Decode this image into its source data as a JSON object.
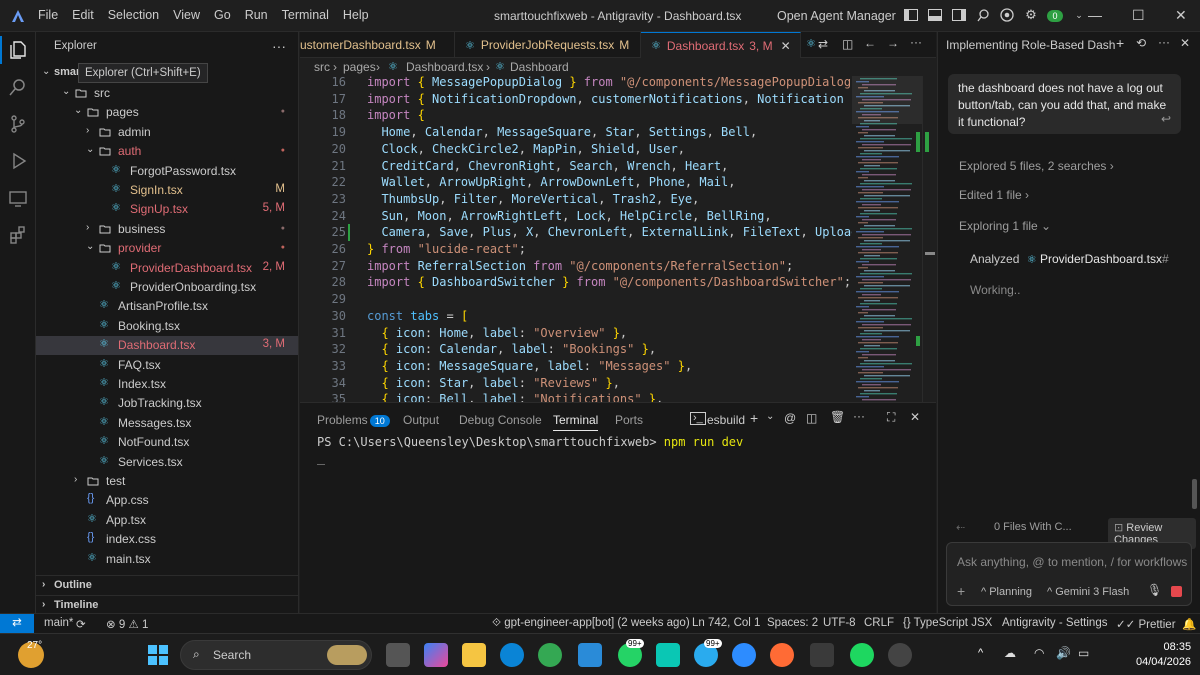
{
  "window": {
    "title": "smarttouchfixweb - Antigravity - Dashboard.tsx",
    "agent_manager": "Open Agent Manager",
    "badge": "0"
  },
  "menu": [
    "File",
    "Edit",
    "Selection",
    "View",
    "Go",
    "Run",
    "Terminal",
    "Help"
  ],
  "sidebar": {
    "title": "Explorer",
    "tooltip": "Explorer (Ctrl+Shift+E)",
    "root": "smar",
    "items": [
      {
        "name": "src",
        "depth": 1,
        "type": "folder",
        "open": true
      },
      {
        "name": "pages",
        "depth": 2,
        "type": "folder",
        "open": true,
        "dot": true
      },
      {
        "name": "admin",
        "depth": 3,
        "type": "folder",
        "open": false
      },
      {
        "name": "auth",
        "depth": 3,
        "type": "folder",
        "open": true,
        "dot": true,
        "color": "#e06c75"
      },
      {
        "name": "ForgotPassword.tsx",
        "depth": 4,
        "type": "file"
      },
      {
        "name": "SignIn.tsx",
        "depth": 4,
        "type": "file",
        "status": "M",
        "color": "#e2c08d"
      },
      {
        "name": "SignUp.tsx",
        "depth": 4,
        "type": "file",
        "status": "5, M",
        "color": "#e06c75"
      },
      {
        "name": "business",
        "depth": 3,
        "type": "folder",
        "open": false,
        "dot": true
      },
      {
        "name": "provider",
        "depth": 3,
        "type": "folder",
        "open": true,
        "dot": true,
        "color": "#e06c75"
      },
      {
        "name": "ProviderDashboard.tsx",
        "depth": 4,
        "type": "file",
        "status": "2, M",
        "color": "#e06c75"
      },
      {
        "name": "ProviderOnboarding.tsx",
        "depth": 4,
        "type": "file"
      },
      {
        "name": "ArtisanProfile.tsx",
        "depth": 3,
        "type": "file"
      },
      {
        "name": "Booking.tsx",
        "depth": 3,
        "type": "file"
      },
      {
        "name": "Dashboard.tsx",
        "depth": 3,
        "type": "file",
        "status": "3, M",
        "color": "#e06c75",
        "selected": true
      },
      {
        "name": "FAQ.tsx",
        "depth": 3,
        "type": "file"
      },
      {
        "name": "Index.tsx",
        "depth": 3,
        "type": "file"
      },
      {
        "name": "JobTracking.tsx",
        "depth": 3,
        "type": "file"
      },
      {
        "name": "Messages.tsx",
        "depth": 3,
        "type": "file"
      },
      {
        "name": "NotFound.tsx",
        "depth": 3,
        "type": "file"
      },
      {
        "name": "Services.tsx",
        "depth": 3,
        "type": "file"
      },
      {
        "name": "test",
        "depth": 2,
        "type": "folder",
        "open": false
      },
      {
        "name": "App.css",
        "depth": 2,
        "type": "css"
      },
      {
        "name": "App.tsx",
        "depth": 2,
        "type": "file"
      },
      {
        "name": "index.css",
        "depth": 2,
        "type": "css"
      },
      {
        "name": "main.tsx",
        "depth": 2,
        "type": "file"
      }
    ],
    "outline": "Outline",
    "timeline": "Timeline"
  },
  "tabs": [
    {
      "label": "ustomerDashboard.tsx",
      "status": "M"
    },
    {
      "label": "ProviderJobRequests.tsx",
      "status": "M"
    },
    {
      "label": "Dashboard.tsx",
      "status": "3, M",
      "active": true
    }
  ],
  "breadcrumb": [
    "src",
    "pages",
    "Dashboard.tsx",
    "Dashboard"
  ],
  "code_lines": [
    {
      "n": "16",
      "t": [
        [
          "kw",
          "import "
        ],
        [
          "br",
          "{ "
        ],
        [
          "id",
          "MessagePopupDialog "
        ],
        [
          "br",
          "} "
        ],
        [
          "kw",
          "from "
        ],
        [
          "str",
          "\"@/components/MessagePopupDialog\""
        ],
        [
          "pn",
          ";"
        ]
      ]
    },
    {
      "n": "17",
      "t": [
        [
          "kw",
          "import "
        ],
        [
          "br",
          "{ "
        ],
        [
          "id",
          "NotificationDropdown"
        ],
        [
          "pn",
          ", "
        ],
        [
          "id",
          "customerNotifications"
        ],
        [
          "pn",
          ", "
        ],
        [
          "id",
          "Notification "
        ],
        [
          "br",
          "} "
        ],
        [
          "kw",
          "fro"
        ]
      ]
    },
    {
      "n": "18",
      "t": [
        [
          "kw",
          "import "
        ],
        [
          "br",
          "{"
        ]
      ]
    },
    {
      "n": "19",
      "t": [
        [
          "id",
          "  Home"
        ],
        [
          "pn",
          ", "
        ],
        [
          "id",
          "Calendar"
        ],
        [
          "pn",
          ", "
        ],
        [
          "id",
          "MessageSquare"
        ],
        [
          "pn",
          ", "
        ],
        [
          "id",
          "Star"
        ],
        [
          "pn",
          ", "
        ],
        [
          "id",
          "Settings"
        ],
        [
          "pn",
          ", "
        ],
        [
          "id",
          "Bell"
        ],
        [
          "pn",
          ","
        ]
      ]
    },
    {
      "n": "20",
      "t": [
        [
          "id",
          "  Clock"
        ],
        [
          "pn",
          ", "
        ],
        [
          "id",
          "CheckCircle2"
        ],
        [
          "pn",
          ", "
        ],
        [
          "id",
          "MapPin"
        ],
        [
          "pn",
          ", "
        ],
        [
          "id",
          "Shield"
        ],
        [
          "pn",
          ", "
        ],
        [
          "id",
          "User"
        ],
        [
          "pn",
          ","
        ]
      ]
    },
    {
      "n": "21",
      "t": [
        [
          "id",
          "  CreditCard"
        ],
        [
          "pn",
          ", "
        ],
        [
          "id",
          "ChevronRight"
        ],
        [
          "pn",
          ", "
        ],
        [
          "id",
          "Search"
        ],
        [
          "pn",
          ", "
        ],
        [
          "id",
          "Wrench"
        ],
        [
          "pn",
          ", "
        ],
        [
          "id",
          "Heart"
        ],
        [
          "pn",
          ","
        ]
      ]
    },
    {
      "n": "22",
      "t": [
        [
          "id",
          "  Wallet"
        ],
        [
          "pn",
          ", "
        ],
        [
          "id",
          "ArrowUpRight"
        ],
        [
          "pn",
          ", "
        ],
        [
          "id",
          "ArrowDownLeft"
        ],
        [
          "pn",
          ", "
        ],
        [
          "id",
          "Phone"
        ],
        [
          "pn",
          ", "
        ],
        [
          "id",
          "Mail"
        ],
        [
          "pn",
          ","
        ]
      ]
    },
    {
      "n": "23",
      "t": [
        [
          "id",
          "  ThumbsUp"
        ],
        [
          "pn",
          ", "
        ],
        [
          "id",
          "Filter"
        ],
        [
          "pn",
          ", "
        ],
        [
          "id",
          "MoreVertical"
        ],
        [
          "pn",
          ", "
        ],
        [
          "id",
          "Trash2"
        ],
        [
          "pn",
          ", "
        ],
        [
          "id",
          "Eye"
        ],
        [
          "pn",
          ","
        ]
      ]
    },
    {
      "n": "24",
      "t": [
        [
          "id",
          "  Sun"
        ],
        [
          "pn",
          ", "
        ],
        [
          "id",
          "Moon"
        ],
        [
          "pn",
          ", "
        ],
        [
          "id",
          "ArrowRightLeft"
        ],
        [
          "pn",
          ", "
        ],
        [
          "id",
          "Lock"
        ],
        [
          "pn",
          ", "
        ],
        [
          "id",
          "HelpCircle"
        ],
        [
          "pn",
          ", "
        ],
        [
          "id",
          "BellRing"
        ],
        [
          "pn",
          ","
        ]
      ]
    },
    {
      "n": "25",
      "t": [
        [
          "id",
          "  Camera"
        ],
        [
          "pn",
          ", "
        ],
        [
          "id",
          "Save"
        ],
        [
          "pn",
          ", "
        ],
        [
          "id",
          "Plus"
        ],
        [
          "pn",
          ", "
        ],
        [
          "id",
          "X"
        ],
        [
          "pn",
          ", "
        ],
        [
          "id",
          "ChevronLeft"
        ],
        [
          "pn",
          ", "
        ],
        [
          "id",
          "ExternalLink"
        ],
        [
          "pn",
          ", "
        ],
        [
          "id",
          "FileText"
        ],
        [
          "pn",
          ", "
        ],
        [
          "id",
          "Upload"
        ],
        [
          "pn",
          ", "
        ],
        [
          "id",
          "Al"
        ]
      ]
    },
    {
      "n": "26",
      "t": [
        [
          "br",
          "} "
        ],
        [
          "kw",
          "from "
        ],
        [
          "str",
          "\"lucide-react\""
        ],
        [
          "pn",
          ";"
        ]
      ]
    },
    {
      "n": "27",
      "t": [
        [
          "kw",
          "import "
        ],
        [
          "id",
          "ReferralSection "
        ],
        [
          "kw",
          "from "
        ],
        [
          "str",
          "\"@/components/ReferralSection\""
        ],
        [
          "pn",
          ";"
        ]
      ]
    },
    {
      "n": "28",
      "t": [
        [
          "kw",
          "import "
        ],
        [
          "br",
          "{ "
        ],
        [
          "id",
          "DashboardSwitcher "
        ],
        [
          "br",
          "} "
        ],
        [
          "kw",
          "from "
        ],
        [
          "str",
          "\"@/components/DashboardSwitcher\""
        ],
        [
          "pn",
          ";"
        ]
      ]
    },
    {
      "n": "29",
      "t": []
    },
    {
      "n": "30",
      "t": [
        [
          "dec",
          "const "
        ],
        [
          "cst",
          "tabs "
        ],
        [
          "pn",
          "= "
        ],
        [
          "br",
          "["
        ]
      ]
    },
    {
      "n": "31",
      "t": [
        [
          "pn",
          "  "
        ],
        [
          "br",
          "{ "
        ],
        [
          "id",
          "icon"
        ],
        [
          "pn",
          ": "
        ],
        [
          "id",
          "Home"
        ],
        [
          "pn",
          ", "
        ],
        [
          "id",
          "label"
        ],
        [
          "pn",
          ": "
        ],
        [
          "str",
          "\"Overview\" "
        ],
        [
          "br",
          "}"
        ],
        [
          "pn",
          ","
        ]
      ]
    },
    {
      "n": "32",
      "t": [
        [
          "pn",
          "  "
        ],
        [
          "br",
          "{ "
        ],
        [
          "id",
          "icon"
        ],
        [
          "pn",
          ": "
        ],
        [
          "id",
          "Calendar"
        ],
        [
          "pn",
          ", "
        ],
        [
          "id",
          "label"
        ],
        [
          "pn",
          ": "
        ],
        [
          "str",
          "\"Bookings\" "
        ],
        [
          "br",
          "}"
        ],
        [
          "pn",
          ","
        ]
      ]
    },
    {
      "n": "33",
      "t": [
        [
          "pn",
          "  "
        ],
        [
          "br",
          "{ "
        ],
        [
          "id",
          "icon"
        ],
        [
          "pn",
          ": "
        ],
        [
          "id",
          "MessageSquare"
        ],
        [
          "pn",
          ", "
        ],
        [
          "id",
          "label"
        ],
        [
          "pn",
          ": "
        ],
        [
          "str",
          "\"Messages\" "
        ],
        [
          "br",
          "}"
        ],
        [
          "pn",
          ","
        ]
      ]
    },
    {
      "n": "34",
      "t": [
        [
          "pn",
          "  "
        ],
        [
          "br",
          "{ "
        ],
        [
          "id",
          "icon"
        ],
        [
          "pn",
          ": "
        ],
        [
          "id",
          "Star"
        ],
        [
          "pn",
          ", "
        ],
        [
          "id",
          "label"
        ],
        [
          "pn",
          ": "
        ],
        [
          "str",
          "\"Reviews\" "
        ],
        [
          "br",
          "}"
        ],
        [
          "pn",
          ","
        ]
      ]
    },
    {
      "n": "35",
      "t": [
        [
          "pn",
          "  "
        ],
        [
          "br",
          "{ "
        ],
        [
          "id",
          "icon"
        ],
        [
          "pn",
          ": "
        ],
        [
          "id",
          "Bell"
        ],
        [
          "pn",
          ", "
        ],
        [
          "id",
          "label"
        ],
        [
          "pn",
          ": "
        ],
        [
          "str",
          "\"Notifications\" "
        ],
        [
          "br",
          "}"
        ],
        [
          "pn",
          ","
        ]
      ]
    }
  ],
  "panel": {
    "tabs": [
      "Problems",
      "Output",
      "Debug Console",
      "Terminal",
      "Ports"
    ],
    "problems_count": "10",
    "terminal_name": "esbuild",
    "prompt": "PS C:\\Users\\Queensley\\Desktop\\smarttouchfixweb> ",
    "command": "npm run dev"
  },
  "agent": {
    "title": "Implementing Role-Based Dashl",
    "message": "the dashboard does not have a log out button/tab, can you add that, and make it functional?",
    "explored": "Explored 5 files, 2 searches",
    "edited": "Edited 1 file",
    "exploring": "Exploring 1 file",
    "analyzed_label": "Analyzed",
    "analyzed_file": "ProviderDashboard.tsx",
    "analyzed_suffix": "#",
    "working": "Working..",
    "files_changed": "0 Files With C...",
    "review": "Review Changes",
    "input_placeholder": "Ask anything, @ to mention, / for workflows",
    "mode": "Planning",
    "model": "Gemini 3 Flash"
  },
  "status": {
    "branch": "main*",
    "errors": "9",
    "warnings": "1",
    "blame": "gpt-engineer-app[bot] (2 weeks ago)",
    "position": "Ln 742, Col 1",
    "spaces": "Spaces: 2",
    "encoding": "UTF-8",
    "eol": "CRLF",
    "language": "TypeScript JSX",
    "settings": "Antigravity - Settings",
    "prettier": "Prettier"
  },
  "taskbar": {
    "temp": "27°",
    "search": "Search",
    "time": "08:35",
    "date": "04/04/2026",
    "badge1": "99+",
    "badge2": "99+",
    "badge3": "0"
  }
}
